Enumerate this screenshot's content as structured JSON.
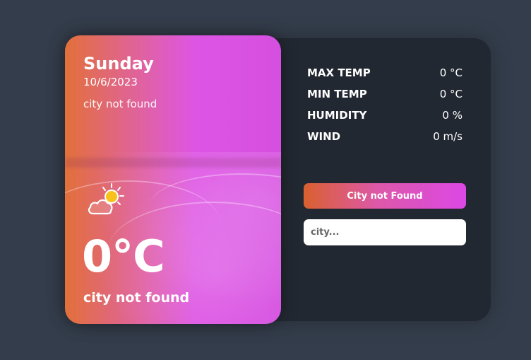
{
  "card": {
    "day": "Sunday",
    "date": "10/6/2023",
    "location": "city not found",
    "temperature": "0°C",
    "description": "city not found",
    "weather_icon": "partly-cloudy-icon"
  },
  "stats": [
    {
      "label": "MAX TEMP",
      "value": "0 °C"
    },
    {
      "label": "MIN TEMP",
      "value": "0 °C"
    },
    {
      "label": "HUMIDITY",
      "value": "0 %"
    },
    {
      "label": "WIND",
      "value": "0 m/s"
    }
  ],
  "search": {
    "button_label": "City not Found",
    "placeholder": "city..."
  },
  "colors": {
    "background": "#343d4b",
    "panel": "#222831",
    "gradient_start": "#e2703a",
    "gradient_end": "#dd55e4"
  }
}
